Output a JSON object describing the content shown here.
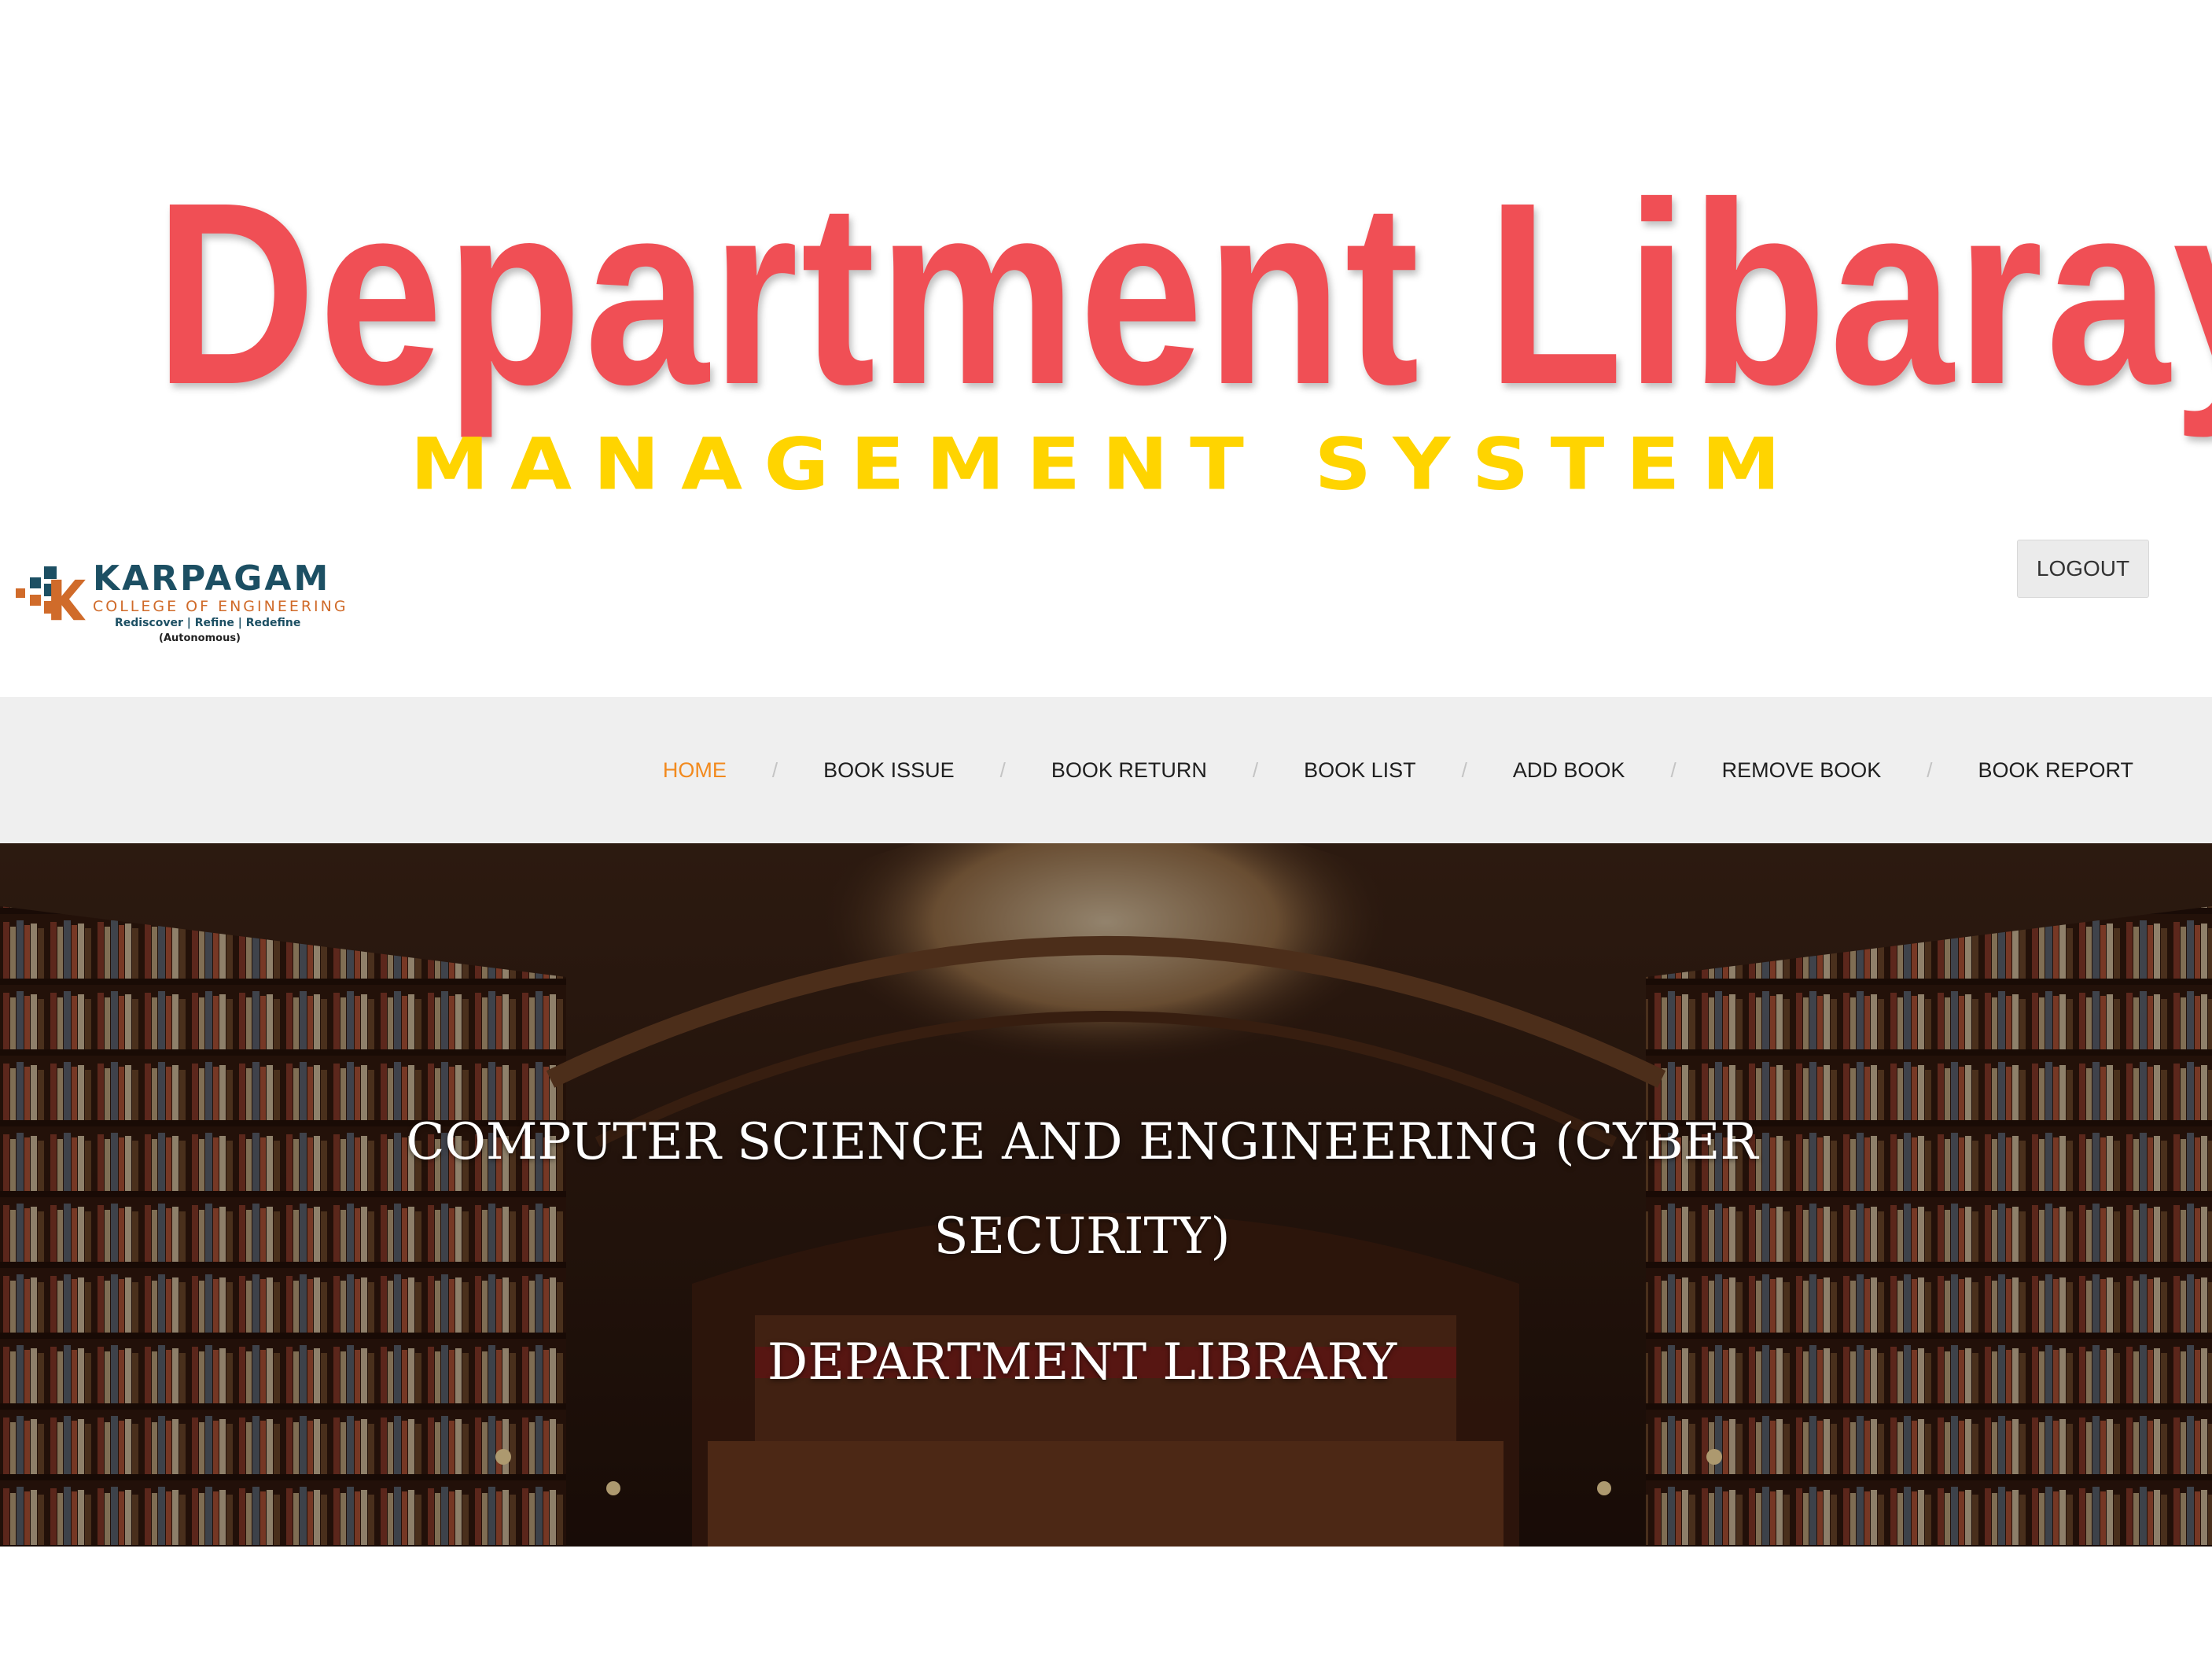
{
  "banner": {
    "title": "Department Libaray",
    "subtitle": "MANAGEMENT SYSTEM",
    "title_color": "#f04f55",
    "subtitle_color": "#ffd400"
  },
  "header": {
    "logo": {
      "name": "KARPAGAM",
      "college": "COLLEGE OF ENGINEERING",
      "tagline": "Rediscover | Refine | Redefine",
      "status": "(Autonomous)",
      "colors": {
        "primary": "#1c4f63",
        "accent": "#d06b2a"
      }
    },
    "logout_label": "LOGOUT"
  },
  "nav": {
    "items": [
      {
        "label": "HOME",
        "active": true
      },
      {
        "label": "BOOK ISSUE",
        "active": false
      },
      {
        "label": "BOOK RETURN",
        "active": false
      },
      {
        "label": "BOOK LIST",
        "active": false
      },
      {
        "label": "ADD BOOK",
        "active": false
      },
      {
        "label": "REMOVE BOOK",
        "active": false
      },
      {
        "label": "BOOK REPORT",
        "active": false
      }
    ],
    "separator": "/",
    "active_color": "#f28a1e"
  },
  "hero": {
    "heading": "COMPUTER SCIENCE AND ENGINEERING (CYBER SECURITY)",
    "subheading": "DEPARTMENT LIBRARY",
    "background": "library-interior-image"
  }
}
